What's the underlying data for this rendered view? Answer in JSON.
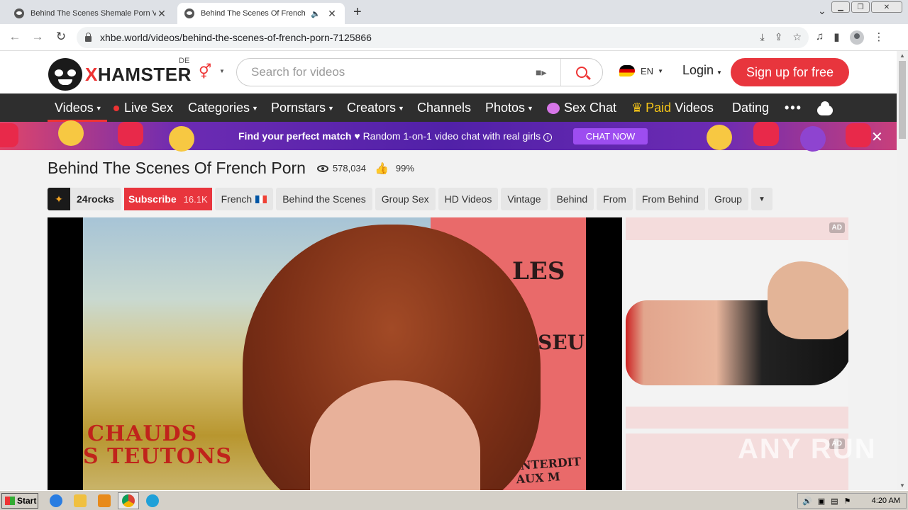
{
  "browser": {
    "tabs": [
      {
        "title": "Behind The Scenes Shemale Porn Vid",
        "active": false
      },
      {
        "title": "Behind The Scenes Of French P",
        "active": true
      }
    ],
    "url": "xhbe.world/videos/behind-the-scenes-of-french-porn-7125866"
  },
  "site": {
    "logo_prefix": "X",
    "logo_rest": "HAMSTER",
    "region": "DE",
    "search_placeholder": "Search for videos",
    "language": "EN",
    "login_label": "Login",
    "signup_label": "Sign up for free"
  },
  "nav": {
    "videos": "Videos",
    "live_sex": "Live Sex",
    "categories": "Categories",
    "pornstars": "Pornstars",
    "creators": "Creators",
    "channels": "Channels",
    "photos": "Photos",
    "sex_chat": "Sex Chat",
    "paid": "Paid",
    "paid_videos": "Videos",
    "dating": "Dating",
    "more": "•••"
  },
  "banner": {
    "headline": "Find your perfect match",
    "subtext": "Random 1-on-1 video chat with real girls",
    "cta": "CHAT NOW"
  },
  "video": {
    "title": "Behind The Scenes Of French Porn",
    "views": "578,034",
    "likes": "99%",
    "channel": "24rocks",
    "subscribe_label": "Subscribe",
    "subscribers": "16.1K",
    "tags": [
      "French",
      "Behind the Scenes",
      "Group Sex",
      "HD Videos",
      "Vintage",
      "Behind",
      "From",
      "From Behind",
      "Group"
    ],
    "frame_text": {
      "poster_line1": "CHAUDS",
      "poster_line2": "S TEUTONS",
      "wall_line1": "LES",
      "wall_line2": "ISEU",
      "wall_line3": "INTERDIT AUX M"
    }
  },
  "ads": {
    "badge": "AD"
  },
  "watermark": "ANY RUN",
  "taskbar": {
    "start_label": "Start",
    "clock": "4:20 AM"
  }
}
